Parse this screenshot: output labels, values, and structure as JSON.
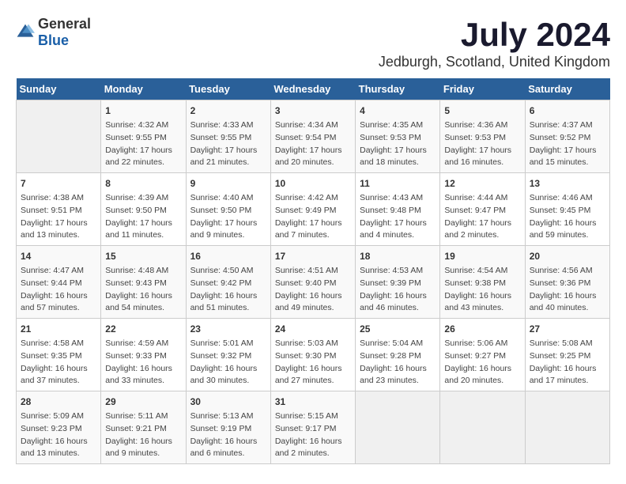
{
  "header": {
    "logo_general": "General",
    "logo_blue": "Blue",
    "month_year": "July 2024",
    "location": "Jedburgh, Scotland, United Kingdom"
  },
  "days_of_week": [
    "Sunday",
    "Monday",
    "Tuesday",
    "Wednesday",
    "Thursday",
    "Friday",
    "Saturday"
  ],
  "weeks": [
    [
      {
        "day": "",
        "sunrise": "",
        "sunset": "",
        "daylight": ""
      },
      {
        "day": "1",
        "sunrise": "Sunrise: 4:32 AM",
        "sunset": "Sunset: 9:55 PM",
        "daylight": "Daylight: 17 hours and 22 minutes."
      },
      {
        "day": "2",
        "sunrise": "Sunrise: 4:33 AM",
        "sunset": "Sunset: 9:55 PM",
        "daylight": "Daylight: 17 hours and 21 minutes."
      },
      {
        "day": "3",
        "sunrise": "Sunrise: 4:34 AM",
        "sunset": "Sunset: 9:54 PM",
        "daylight": "Daylight: 17 hours and 20 minutes."
      },
      {
        "day": "4",
        "sunrise": "Sunrise: 4:35 AM",
        "sunset": "Sunset: 9:53 PM",
        "daylight": "Daylight: 17 hours and 18 minutes."
      },
      {
        "day": "5",
        "sunrise": "Sunrise: 4:36 AM",
        "sunset": "Sunset: 9:53 PM",
        "daylight": "Daylight: 17 hours and 16 minutes."
      },
      {
        "day": "6",
        "sunrise": "Sunrise: 4:37 AM",
        "sunset": "Sunset: 9:52 PM",
        "daylight": "Daylight: 17 hours and 15 minutes."
      }
    ],
    [
      {
        "day": "7",
        "sunrise": "Sunrise: 4:38 AM",
        "sunset": "Sunset: 9:51 PM",
        "daylight": "Daylight: 17 hours and 13 minutes."
      },
      {
        "day": "8",
        "sunrise": "Sunrise: 4:39 AM",
        "sunset": "Sunset: 9:50 PM",
        "daylight": "Daylight: 17 hours and 11 minutes."
      },
      {
        "day": "9",
        "sunrise": "Sunrise: 4:40 AM",
        "sunset": "Sunset: 9:50 PM",
        "daylight": "Daylight: 17 hours and 9 minutes."
      },
      {
        "day": "10",
        "sunrise": "Sunrise: 4:42 AM",
        "sunset": "Sunset: 9:49 PM",
        "daylight": "Daylight: 17 hours and 7 minutes."
      },
      {
        "day": "11",
        "sunrise": "Sunrise: 4:43 AM",
        "sunset": "Sunset: 9:48 PM",
        "daylight": "Daylight: 17 hours and 4 minutes."
      },
      {
        "day": "12",
        "sunrise": "Sunrise: 4:44 AM",
        "sunset": "Sunset: 9:47 PM",
        "daylight": "Daylight: 17 hours and 2 minutes."
      },
      {
        "day": "13",
        "sunrise": "Sunrise: 4:46 AM",
        "sunset": "Sunset: 9:45 PM",
        "daylight": "Daylight: 16 hours and 59 minutes."
      }
    ],
    [
      {
        "day": "14",
        "sunrise": "Sunrise: 4:47 AM",
        "sunset": "Sunset: 9:44 PM",
        "daylight": "Daylight: 16 hours and 57 minutes."
      },
      {
        "day": "15",
        "sunrise": "Sunrise: 4:48 AM",
        "sunset": "Sunset: 9:43 PM",
        "daylight": "Daylight: 16 hours and 54 minutes."
      },
      {
        "day": "16",
        "sunrise": "Sunrise: 4:50 AM",
        "sunset": "Sunset: 9:42 PM",
        "daylight": "Daylight: 16 hours and 51 minutes."
      },
      {
        "day": "17",
        "sunrise": "Sunrise: 4:51 AM",
        "sunset": "Sunset: 9:40 PM",
        "daylight": "Daylight: 16 hours and 49 minutes."
      },
      {
        "day": "18",
        "sunrise": "Sunrise: 4:53 AM",
        "sunset": "Sunset: 9:39 PM",
        "daylight": "Daylight: 16 hours and 46 minutes."
      },
      {
        "day": "19",
        "sunrise": "Sunrise: 4:54 AM",
        "sunset": "Sunset: 9:38 PM",
        "daylight": "Daylight: 16 hours and 43 minutes."
      },
      {
        "day": "20",
        "sunrise": "Sunrise: 4:56 AM",
        "sunset": "Sunset: 9:36 PM",
        "daylight": "Daylight: 16 hours and 40 minutes."
      }
    ],
    [
      {
        "day": "21",
        "sunrise": "Sunrise: 4:58 AM",
        "sunset": "Sunset: 9:35 PM",
        "daylight": "Daylight: 16 hours and 37 minutes."
      },
      {
        "day": "22",
        "sunrise": "Sunrise: 4:59 AM",
        "sunset": "Sunset: 9:33 PM",
        "daylight": "Daylight: 16 hours and 33 minutes."
      },
      {
        "day": "23",
        "sunrise": "Sunrise: 5:01 AM",
        "sunset": "Sunset: 9:32 PM",
        "daylight": "Daylight: 16 hours and 30 minutes."
      },
      {
        "day": "24",
        "sunrise": "Sunrise: 5:03 AM",
        "sunset": "Sunset: 9:30 PM",
        "daylight": "Daylight: 16 hours and 27 minutes."
      },
      {
        "day": "25",
        "sunrise": "Sunrise: 5:04 AM",
        "sunset": "Sunset: 9:28 PM",
        "daylight": "Daylight: 16 hours and 23 minutes."
      },
      {
        "day": "26",
        "sunrise": "Sunrise: 5:06 AM",
        "sunset": "Sunset: 9:27 PM",
        "daylight": "Daylight: 16 hours and 20 minutes."
      },
      {
        "day": "27",
        "sunrise": "Sunrise: 5:08 AM",
        "sunset": "Sunset: 9:25 PM",
        "daylight": "Daylight: 16 hours and 17 minutes."
      }
    ],
    [
      {
        "day": "28",
        "sunrise": "Sunrise: 5:09 AM",
        "sunset": "Sunset: 9:23 PM",
        "daylight": "Daylight: 16 hours and 13 minutes."
      },
      {
        "day": "29",
        "sunrise": "Sunrise: 5:11 AM",
        "sunset": "Sunset: 9:21 PM",
        "daylight": "Daylight: 16 hours and 9 minutes."
      },
      {
        "day": "30",
        "sunrise": "Sunrise: 5:13 AM",
        "sunset": "Sunset: 9:19 PM",
        "daylight": "Daylight: 16 hours and 6 minutes."
      },
      {
        "day": "31",
        "sunrise": "Sunrise: 5:15 AM",
        "sunset": "Sunset: 9:17 PM",
        "daylight": "Daylight: 16 hours and 2 minutes."
      },
      {
        "day": "",
        "sunrise": "",
        "sunset": "",
        "daylight": ""
      },
      {
        "day": "",
        "sunrise": "",
        "sunset": "",
        "daylight": ""
      },
      {
        "day": "",
        "sunrise": "",
        "sunset": "",
        "daylight": ""
      }
    ]
  ]
}
